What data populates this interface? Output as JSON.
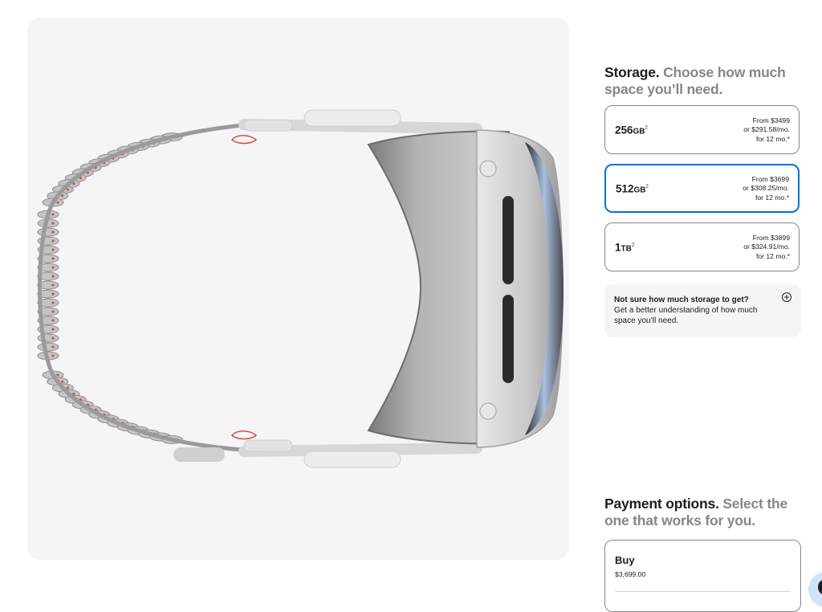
{
  "product_image": {
    "alt_subject": "Apple Vision Pro headset, top view"
  },
  "storage": {
    "heading_bold": "Storage.",
    "heading_muted": "Choose how much space you’ll need.",
    "options": [
      {
        "size": "256",
        "unit": "GB",
        "footnote": "2",
        "price_from": "From $3499",
        "price_monthly": "or $291.58/mo.",
        "term": "for 12 mo.*",
        "selected": false
      },
      {
        "size": "512",
        "unit": "GB",
        "footnote": "2",
        "price_from": "From $3699",
        "price_monthly": "or $308.25/mo.",
        "term": "for 12 mo.*",
        "selected": true
      },
      {
        "size": "1",
        "unit": "TB",
        "footnote": "2",
        "price_from": "From $3899",
        "price_monthly": "or $324.91/mo.",
        "term": "for 12 mo.*",
        "selected": false
      }
    ],
    "helper": {
      "title": "Not sure how much storage to get?",
      "body": "Get a better understanding of how much space you’ll need.",
      "icon": "plus-circle-icon"
    }
  },
  "payment": {
    "heading_bold": "Payment options.",
    "heading_muted": "Select the one that works for you.",
    "buy": {
      "title": "Buy",
      "price": "$3,699.00"
    }
  },
  "colors": {
    "accent": "#0071e3",
    "muted_text": "#86868b",
    "panel_bg": "#f5f5f7"
  }
}
